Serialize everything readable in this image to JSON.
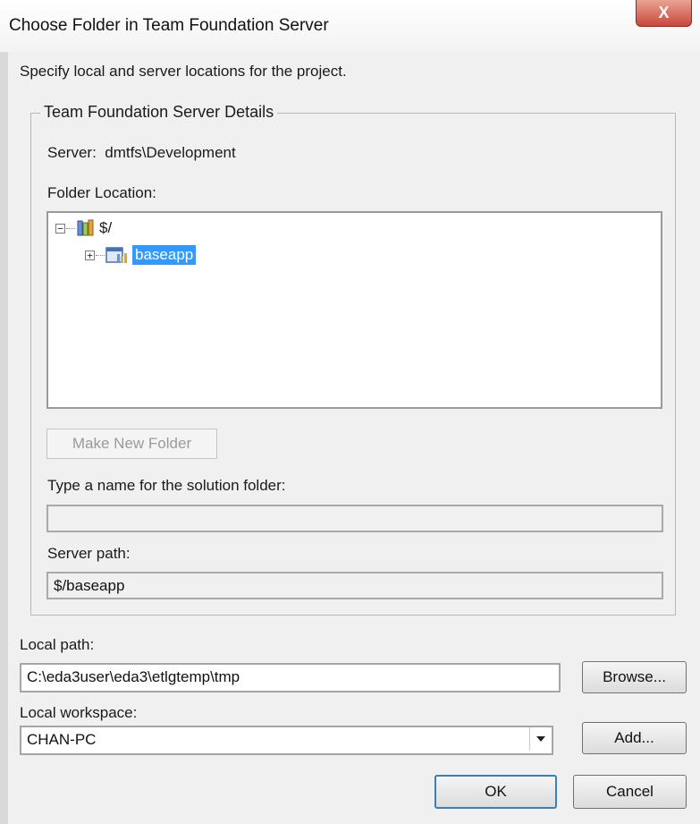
{
  "window": {
    "title": "Choose Folder in Team Foundation Server",
    "close_glyph": "X"
  },
  "instructions": "Specify local and server locations for the project.",
  "group": {
    "legend": "Team Foundation Server Details",
    "server_label": "Server:",
    "server_value": "dmtfs\\Development",
    "folder_location_label": "Folder Location:"
  },
  "tree": {
    "root": {
      "label": "$/",
      "expander": "−",
      "icon": "tfs-server-icon"
    },
    "child": {
      "label": "baseapp",
      "expander": "+",
      "icon": "team-project-icon",
      "selected": true
    }
  },
  "make_new_folder_label": "Make New Folder",
  "solution_folder": {
    "label": "Type a name for the solution folder:",
    "value": ""
  },
  "server_path": {
    "label": "Server path:",
    "value": "$/baseapp"
  },
  "local_path": {
    "label": "Local path:",
    "value": "C:\\eda3user\\eda3\\etlgtemp\\tmp",
    "browse_label": "Browse..."
  },
  "local_workspace": {
    "label": "Local workspace:",
    "value": "CHAN-PC",
    "add_label": "Add..."
  },
  "buttons": {
    "ok": "OK",
    "cancel": "Cancel"
  },
  "colors": {
    "selection": "#3399ff",
    "close_button": "#c8473a",
    "dialog_bg": "#f0f0f0"
  }
}
